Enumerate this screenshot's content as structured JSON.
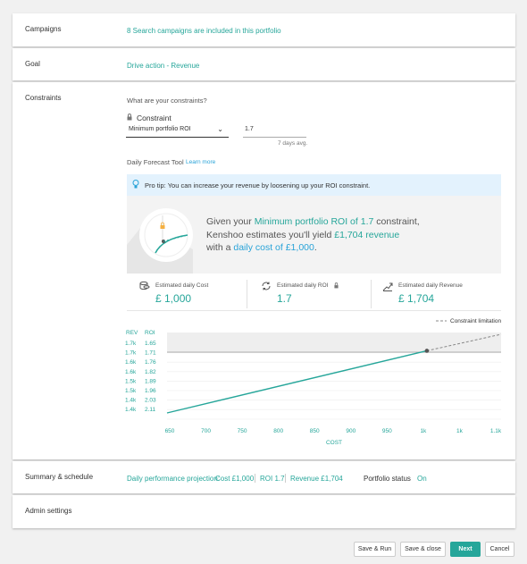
{
  "campaigns": {
    "label": "Campaigns",
    "value": "8 Search campaigns are included in this portfolio"
  },
  "goal": {
    "label": "Goal",
    "value": "Drive action - Revenue"
  },
  "constraints": {
    "label": "Constraints",
    "question": "What are your constraints?",
    "constraint_label": "Constraint",
    "select_value": "Minimum portfolio ROI",
    "input_value": "1.7",
    "input_hint": "7 days avg.",
    "forecast_tool": "Daily Forecast Tool",
    "learn_more": "Learn more",
    "tip": "Pro tip: You can increase your revenue by loosening up your ROI constraint.",
    "msg": {
      "p1": "Given your ",
      "p2": "Minimum portfolio ROI of 1.7",
      "p3": " constraint,",
      "p4": "Kenshoo estimates you'll yield ",
      "p5": "£1,704 revenue",
      "p6": "with a ",
      "p7": "daily cost of £1,000",
      "p8": "."
    },
    "metrics": [
      {
        "label": "Estimated daily Cost",
        "value": "£ 1,000",
        "icon": "coins-icon"
      },
      {
        "label": "Estimated daily ROI",
        "value": "1.7",
        "icon": "refresh-dollar-icon"
      },
      {
        "label": "Estimated daily Revenue",
        "value": "£ 1,704",
        "icon": "growth-icon"
      }
    ]
  },
  "chart_data": {
    "type": "line",
    "legend": "Constraint limitation",
    "xlabel": "COST",
    "x_ticks": [
      "650",
      "700",
      "750",
      "800",
      "850",
      "900",
      "950",
      "1k",
      "1k",
      "1.1k"
    ],
    "rev_header": "REV",
    "roi_header": "ROI",
    "rev_ticks": [
      "1.7k",
      "1.7k",
      "1.6k",
      "1.6k",
      "1.5k",
      "1.5k",
      "1.4k",
      "1.4k"
    ],
    "roi_ticks": [
      "1.65",
      "1.71",
      "1.76",
      "1.82",
      "1.89",
      "1.96",
      "2.03",
      "2.11"
    ],
    "series": [
      {
        "name": "Revenue",
        "x": [
          650,
          1000
        ],
        "y": [
          1380,
          1704
        ]
      },
      {
        "name": "Constraint limitation",
        "x": [
          1000,
          1100
        ],
        "y": [
          1704,
          1790
        ]
      }
    ],
    "constraint_roi": 1.7,
    "current_point": {
      "x": 1000,
      "y": 1704
    },
    "colors": {
      "line": "#26a69a",
      "dashed": "#888888",
      "shaded": "#eeeeee"
    }
  },
  "summary": {
    "label": "Summary & schedule",
    "projection_label": "Daily performance projection:",
    "cost": "Cost £1,000",
    "roi": "ROI 1.7",
    "revenue": "Revenue £1,704",
    "status_label": "Portfolio status",
    "status_value": "On"
  },
  "admin": {
    "label": "Admin settings"
  },
  "buttons": {
    "save_run": "Save & Run",
    "save_close": "Save & close",
    "next": "Next",
    "cancel": "Cancel"
  },
  "colors": {
    "accent": "#26a69a",
    "link": "#29a3d8"
  }
}
